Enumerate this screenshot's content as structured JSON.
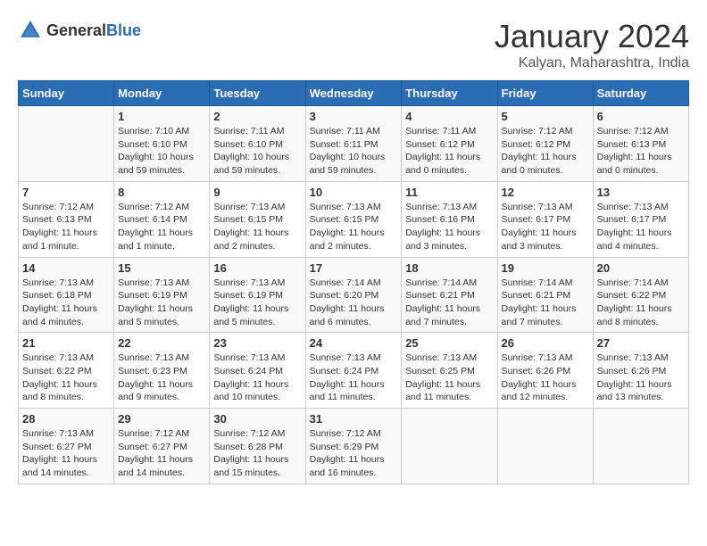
{
  "header": {
    "logo_general": "General",
    "logo_blue": "Blue",
    "month_year": "January 2024",
    "location": "Kalyan, Maharashtra, India"
  },
  "weekdays": [
    "Sunday",
    "Monday",
    "Tuesday",
    "Wednesday",
    "Thursday",
    "Friday",
    "Saturday"
  ],
  "weeks": [
    [
      {
        "day": "",
        "sunrise": "",
        "sunset": "",
        "daylight": ""
      },
      {
        "day": "1",
        "sunrise": "Sunrise: 7:10 AM",
        "sunset": "Sunset: 6:10 PM",
        "daylight": "Daylight: 10 hours and 59 minutes."
      },
      {
        "day": "2",
        "sunrise": "Sunrise: 7:11 AM",
        "sunset": "Sunset: 6:10 PM",
        "daylight": "Daylight: 10 hours and 59 minutes."
      },
      {
        "day": "3",
        "sunrise": "Sunrise: 7:11 AM",
        "sunset": "Sunset: 6:11 PM",
        "daylight": "Daylight: 10 hours and 59 minutes."
      },
      {
        "day": "4",
        "sunrise": "Sunrise: 7:11 AM",
        "sunset": "Sunset: 6:12 PM",
        "daylight": "Daylight: 11 hours and 0 minutes."
      },
      {
        "day": "5",
        "sunrise": "Sunrise: 7:12 AM",
        "sunset": "Sunset: 6:12 PM",
        "daylight": "Daylight: 11 hours and 0 minutes."
      },
      {
        "day": "6",
        "sunrise": "Sunrise: 7:12 AM",
        "sunset": "Sunset: 6:13 PM",
        "daylight": "Daylight: 11 hours and 0 minutes."
      }
    ],
    [
      {
        "day": "7",
        "sunrise": "Sunrise: 7:12 AM",
        "sunset": "Sunset: 6:13 PM",
        "daylight": "Daylight: 11 hours and 1 minute."
      },
      {
        "day": "8",
        "sunrise": "Sunrise: 7:12 AM",
        "sunset": "Sunset: 6:14 PM",
        "daylight": "Daylight: 11 hours and 1 minute."
      },
      {
        "day": "9",
        "sunrise": "Sunrise: 7:13 AM",
        "sunset": "Sunset: 6:15 PM",
        "daylight": "Daylight: 11 hours and 2 minutes."
      },
      {
        "day": "10",
        "sunrise": "Sunrise: 7:13 AM",
        "sunset": "Sunset: 6:15 PM",
        "daylight": "Daylight: 11 hours and 2 minutes."
      },
      {
        "day": "11",
        "sunrise": "Sunrise: 7:13 AM",
        "sunset": "Sunset: 6:16 PM",
        "daylight": "Daylight: 11 hours and 3 minutes."
      },
      {
        "day": "12",
        "sunrise": "Sunrise: 7:13 AM",
        "sunset": "Sunset: 6:17 PM",
        "daylight": "Daylight: 11 hours and 3 minutes."
      },
      {
        "day": "13",
        "sunrise": "Sunrise: 7:13 AM",
        "sunset": "Sunset: 6:17 PM",
        "daylight": "Daylight: 11 hours and 4 minutes."
      }
    ],
    [
      {
        "day": "14",
        "sunrise": "Sunrise: 7:13 AM",
        "sunset": "Sunset: 6:18 PM",
        "daylight": "Daylight: 11 hours and 4 minutes."
      },
      {
        "day": "15",
        "sunrise": "Sunrise: 7:13 AM",
        "sunset": "Sunset: 6:19 PM",
        "daylight": "Daylight: 11 hours and 5 minutes."
      },
      {
        "day": "16",
        "sunrise": "Sunrise: 7:13 AM",
        "sunset": "Sunset: 6:19 PM",
        "daylight": "Daylight: 11 hours and 5 minutes."
      },
      {
        "day": "17",
        "sunrise": "Sunrise: 7:14 AM",
        "sunset": "Sunset: 6:20 PM",
        "daylight": "Daylight: 11 hours and 6 minutes."
      },
      {
        "day": "18",
        "sunrise": "Sunrise: 7:14 AM",
        "sunset": "Sunset: 6:21 PM",
        "daylight": "Daylight: 11 hours and 7 minutes."
      },
      {
        "day": "19",
        "sunrise": "Sunrise: 7:14 AM",
        "sunset": "Sunset: 6:21 PM",
        "daylight": "Daylight: 11 hours and 7 minutes."
      },
      {
        "day": "20",
        "sunrise": "Sunrise: 7:14 AM",
        "sunset": "Sunset: 6:22 PM",
        "daylight": "Daylight: 11 hours and 8 minutes."
      }
    ],
    [
      {
        "day": "21",
        "sunrise": "Sunrise: 7:13 AM",
        "sunset": "Sunset: 6:22 PM",
        "daylight": "Daylight: 11 hours and 8 minutes."
      },
      {
        "day": "22",
        "sunrise": "Sunrise: 7:13 AM",
        "sunset": "Sunset: 6:23 PM",
        "daylight": "Daylight: 11 hours and 9 minutes."
      },
      {
        "day": "23",
        "sunrise": "Sunrise: 7:13 AM",
        "sunset": "Sunset: 6:24 PM",
        "daylight": "Daylight: 11 hours and 10 minutes."
      },
      {
        "day": "24",
        "sunrise": "Sunrise: 7:13 AM",
        "sunset": "Sunset: 6:24 PM",
        "daylight": "Daylight: 11 hours and 11 minutes."
      },
      {
        "day": "25",
        "sunrise": "Sunrise: 7:13 AM",
        "sunset": "Sunset: 6:25 PM",
        "daylight": "Daylight: 11 hours and 11 minutes."
      },
      {
        "day": "26",
        "sunrise": "Sunrise: 7:13 AM",
        "sunset": "Sunset: 6:26 PM",
        "daylight": "Daylight: 11 hours and 12 minutes."
      },
      {
        "day": "27",
        "sunrise": "Sunrise: 7:13 AM",
        "sunset": "Sunset: 6:26 PM",
        "daylight": "Daylight: 11 hours and 13 minutes."
      }
    ],
    [
      {
        "day": "28",
        "sunrise": "Sunrise: 7:13 AM",
        "sunset": "Sunset: 6:27 PM",
        "daylight": "Daylight: 11 hours and 14 minutes."
      },
      {
        "day": "29",
        "sunrise": "Sunrise: 7:12 AM",
        "sunset": "Sunset: 6:27 PM",
        "daylight": "Daylight: 11 hours and 14 minutes."
      },
      {
        "day": "30",
        "sunrise": "Sunrise: 7:12 AM",
        "sunset": "Sunset: 6:28 PM",
        "daylight": "Daylight: 11 hours and 15 minutes."
      },
      {
        "day": "31",
        "sunrise": "Sunrise: 7:12 AM",
        "sunset": "Sunset: 6:29 PM",
        "daylight": "Daylight: 11 hours and 16 minutes."
      },
      {
        "day": "",
        "sunrise": "",
        "sunset": "",
        "daylight": ""
      },
      {
        "day": "",
        "sunrise": "",
        "sunset": "",
        "daylight": ""
      },
      {
        "day": "",
        "sunrise": "",
        "sunset": "",
        "daylight": ""
      }
    ]
  ]
}
